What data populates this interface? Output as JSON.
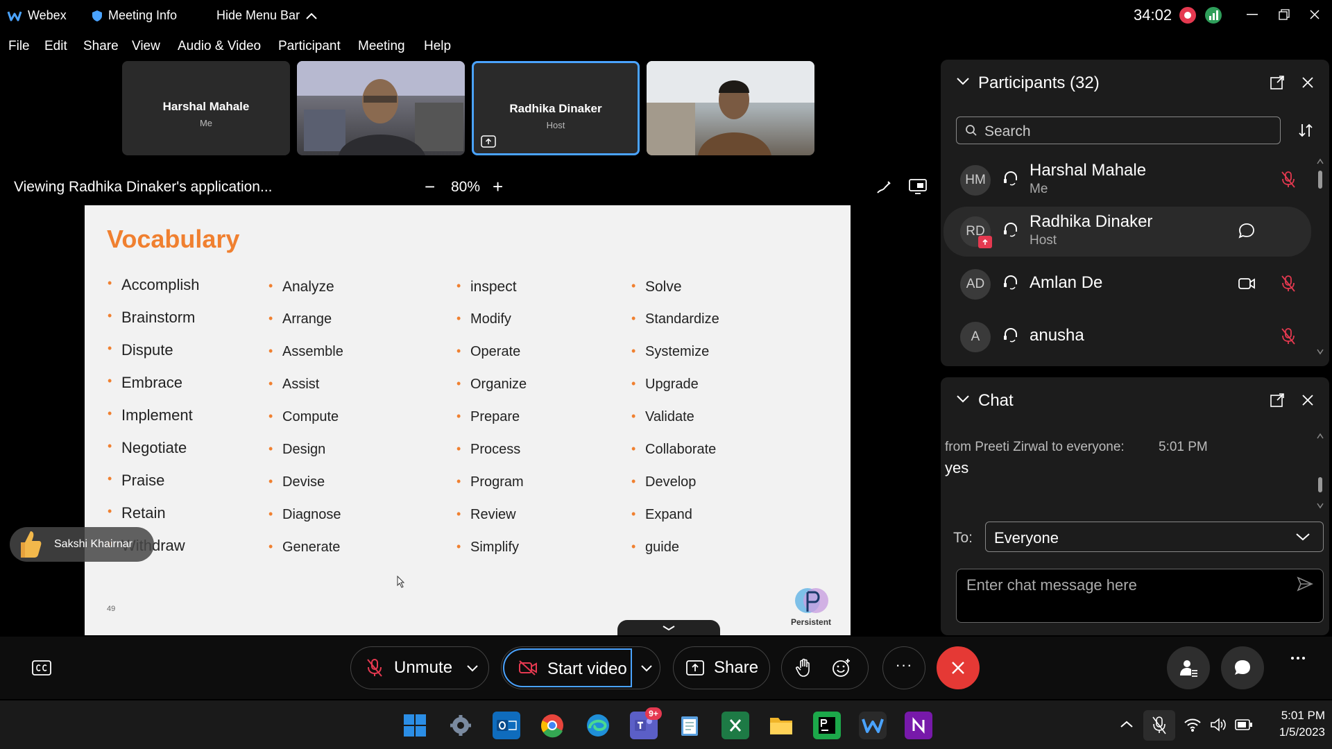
{
  "titlebar": {
    "app_name": "Webex",
    "meeting_info": "Meeting Info",
    "hide_menu": "Hide Menu Bar",
    "timer": "34:02"
  },
  "menu": [
    "File",
    "Edit",
    "Share",
    "View",
    "Audio & Video",
    "Participant",
    "Meeting",
    "Help"
  ],
  "thumbnails": [
    {
      "name": "Harshal Mahale",
      "role": "Me"
    },
    {
      "name": "",
      "role": ""
    },
    {
      "name": "Radhika Dinaker",
      "role": "Host"
    },
    {
      "name": "",
      "role": ""
    }
  ],
  "viewing": {
    "text": "Viewing Radhika Dinaker's application...",
    "zoom": "80%",
    "minus": "−",
    "plus": "+"
  },
  "slide": {
    "title": "Vocabulary",
    "columns": [
      [
        "Accomplish",
        "Brainstorm",
        "Dispute",
        "Embrace",
        "Implement",
        "Negotiate",
        "Praise",
        "Retain",
        "Withdraw"
      ],
      [
        "Analyze",
        "Arrange",
        "Assemble",
        "Assist",
        "Compute",
        "Design",
        "Devise",
        "Diagnose",
        "Generate"
      ],
      [
        "inspect",
        "Modify",
        "Operate",
        "Organize",
        "Prepare",
        "Process",
        "Program",
        "Review",
        "Simplify"
      ],
      [
        "Solve",
        "Standardize",
        "Systemize",
        "Upgrade",
        "Validate",
        "Collaborate",
        "Develop",
        "Expand",
        "guide"
      ]
    ],
    "page_number": "49",
    "logo_text": "Persistent"
  },
  "reaction": {
    "name": "Sakshi Khairnar"
  },
  "participants": {
    "title": "Participants (32)",
    "search_placeholder": "Search",
    "list": [
      {
        "initials": "HM",
        "name": "Harshal Mahale",
        "role": "Me"
      },
      {
        "initials": "RD",
        "name": "Radhika Dinaker",
        "role": "Host"
      },
      {
        "initials": "AD",
        "name": "Amlan De",
        "role": ""
      },
      {
        "initials": "A",
        "name": "anusha",
        "role": ""
      }
    ]
  },
  "chat": {
    "title": "Chat",
    "from": "from Preeti Zirwal to everyone:",
    "time": "5:01 PM",
    "message": "yes",
    "to_label": "To:",
    "to_value": "Everyone",
    "input_placeholder": "Enter chat message here"
  },
  "controls": {
    "unmute": "Unmute",
    "start_video": "Start video",
    "share": "Share",
    "more": "···"
  },
  "taskbar": {
    "time": "5:01 PM",
    "date": "1/5/2023",
    "teams_badge": "9+"
  },
  "colors": {
    "accent_blue": "#4aa3ff",
    "slide_title": "#f08030",
    "end_red": "#e53935"
  }
}
